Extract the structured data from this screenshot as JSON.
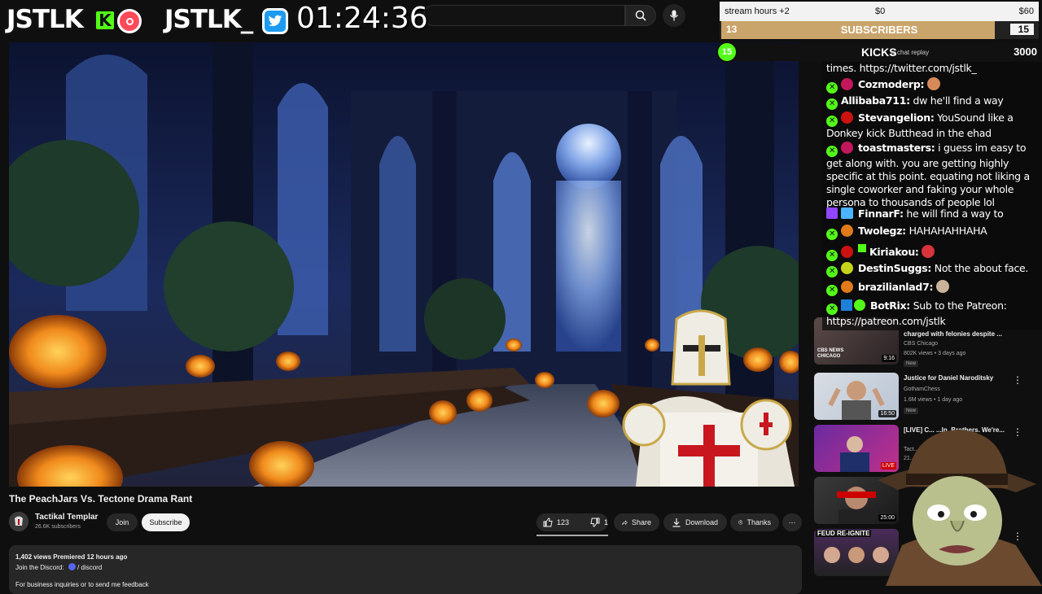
{
  "topbar": {
    "logo_kick": "JSTLK",
    "logo_kick_badge": "K",
    "logo_twitter": "JSTLK_",
    "timer": "01:24:36",
    "icons": [
      "menu-icon",
      "search-icon",
      "mic-icon",
      "kick-icon",
      "record-icon",
      "twitter-icon"
    ]
  },
  "video": {
    "title": "The PeachJars Vs. Tectone Drama Rant",
    "channel": "Tactikal Templar",
    "subscribers": "26.6K subscribers",
    "join_label": "Join",
    "subscribe_label": "Subscribe",
    "likes": "123",
    "dislikes": "1",
    "share_label": "Share",
    "download_label": "Download",
    "thanks_label": "Thanks",
    "more_label": "⋯"
  },
  "description": {
    "meta": "1,402 views  Premiered 12 hours ago",
    "line1": "Join the Discord:",
    "discord_link": "/ discord",
    "line2": "For business inquiries or to send me feedback"
  },
  "overlay": {
    "stream_hours_label": "stream hours +2",
    "money_current": "$0",
    "money_goal": "$60",
    "subs_current": "13",
    "subs_label": "SUBSCRIBERS",
    "subs_goal": "15",
    "subs_progress": 0.867,
    "kicks_current": "15",
    "kicks_label": "KICKS",
    "kicks_goal": "3000",
    "kicks_progress": 0.005,
    "chat_replay_hint": "w chat replay"
  },
  "chat": {
    "top_fragment": "times. https://twitter.com/jstlk_",
    "messages": [
      {
        "user": "Cozmoderp:",
        "text": "",
        "badge_color": "#c2185b",
        "emote_color": "#d68a5a"
      },
      {
        "user": "Allibaba711:",
        "text": "dw he'll find a way",
        "badge_color": "",
        "emote_color": ""
      },
      {
        "user": "Stevangelion:",
        "text": "YouSound like a Donkey kick Butthead in the ehad",
        "badge_color": "#cc1111",
        "emote_color": ""
      },
      {
        "user": "toastmasters:",
        "text": "i guess im easy to get along with. you are getting highly specific at this point. equating not liking a single coworker and faking your whole persona to thousands of people lol",
        "badge_color": "#c2185b",
        "emote_color": ""
      },
      {
        "user": "FinnarF:",
        "text": "he will find a way to",
        "badge_color": "",
        "emote_color": ""
      },
      {
        "user": "Twolegz:",
        "text": "HAHAHAHHAHA",
        "badge_color": "#e07a1a",
        "emote_color": ""
      },
      {
        "user": "Kiriakou:",
        "text": "",
        "badge_color": "#cc1111",
        "emote_color": "#d8333a"
      },
      {
        "user": "DestinSuggs:",
        "text": "Not the about face.",
        "badge_color": "#c5d41a",
        "emote_color": ""
      },
      {
        "user": "brazilianlad7:",
        "text": "",
        "badge_color": "#e07a1a",
        "emote_color": "#c9b49a"
      },
      {
        "user": "BotRix:",
        "text": "Sub to the Patreon: https://patreon.com/jstlk",
        "badge_color": "",
        "emote_color": ""
      }
    ]
  },
  "recommendations": [
    {
      "title": "charged with felonies despite ...",
      "channel": "CBS Chicago",
      "meta": "802K views • 3 days ago",
      "badge": "New",
      "duration": "9:16",
      "thumb_label": "CBS NEWS CHICAGO"
    },
    {
      "title": "Justice for Daniel Naroditsky",
      "channel": "GothamChess",
      "meta": "1.6M views • 1 day ago",
      "badge": "New",
      "duration": "16:50",
      "thumb_label": ""
    },
    {
      "title": "[LIVE] C... ...ln. Brothers. We're...",
      "channel": "Tact...",
      "meta": "21...",
      "badge": "",
      "duration": "LIVE",
      "thumb_label": ""
    },
    {
      "title": "",
      "channel": "",
      "meta": "",
      "badge": "",
      "duration": "25:00",
      "thumb_label": ""
    },
    {
      "title": "",
      "channel": "",
      "meta": "",
      "badge": "",
      "duration": "",
      "thumb_label": "FEUD RE-IGNITE"
    }
  ],
  "colors": {
    "kick_green": "#53fc18",
    "subs_fill": "#caa56b",
    "twitter_blue": "#1d9bf0",
    "yt_bg": "#0f0f0f"
  }
}
